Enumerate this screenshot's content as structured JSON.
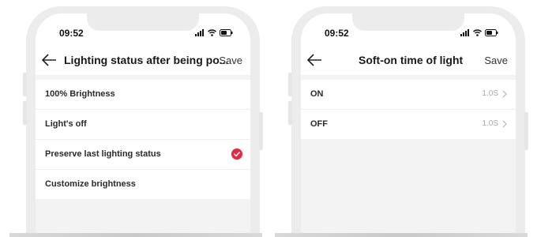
{
  "status_bar": {
    "time": "09:52"
  },
  "screens": [
    {
      "nav_title": "Lighting status after being po...",
      "save_label": "Save",
      "items": [
        {
          "label": "100% Brightness",
          "selected": false
        },
        {
          "label": "Light's off",
          "selected": false
        },
        {
          "label": "Preserve last lighting status",
          "selected": true
        },
        {
          "label": "Customize brightness",
          "selected": false
        }
      ]
    },
    {
      "nav_title": "Soft-on time of light",
      "save_label": "Save",
      "items": [
        {
          "label": "ON",
          "value": "1.0S"
        },
        {
          "label": "OFF",
          "value": "1.0S"
        }
      ]
    }
  ],
  "icons": {
    "back": "arrow-left-icon",
    "check": "check-circle-icon",
    "chevron": "chevron-right-icon",
    "signal": "signal-icon",
    "wifi": "wifi-icon",
    "battery": "battery-icon"
  },
  "colors": {
    "accent": "#e8293f",
    "phone_frame": "#ececec",
    "screen_bg": "#f3f3f3",
    "value_text": "#a8a8a8"
  }
}
